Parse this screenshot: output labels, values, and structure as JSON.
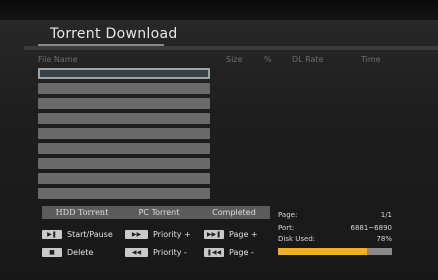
{
  "window": {
    "title": "Torrent Download"
  },
  "columns": [
    "File Name",
    "Size",
    "%",
    "DL Rate",
    "Time"
  ],
  "file_rows": [
    "",
    "",
    "",
    "",
    "",
    "",
    "",
    "",
    ""
  ],
  "tabs": [
    "HDD Torrent",
    "PC Torrent",
    "Completed"
  ],
  "controls": [
    {
      "key": "▶❚",
      "label": "Start/Pause"
    },
    {
      "key": "▶▶",
      "label": "Priority +"
    },
    {
      "key": "▶▶❚",
      "label": "Page +"
    },
    {
      "key": "■",
      "label": "Delete"
    },
    {
      "key": "◀◀",
      "label": "Priority -"
    },
    {
      "key": "❚◀◀",
      "label": "Page -"
    }
  ],
  "status": {
    "page_label": "Page:",
    "page_value": "1/1",
    "port_label": "Port:",
    "port_value": "6881~6890",
    "disk_label": "Disk Used:",
    "disk_value": "78%",
    "disk_fraction": 0.78
  },
  "colors": {
    "progress": "#f0b020",
    "row": "#6a6a6a",
    "accent": "#9aa6ad"
  }
}
